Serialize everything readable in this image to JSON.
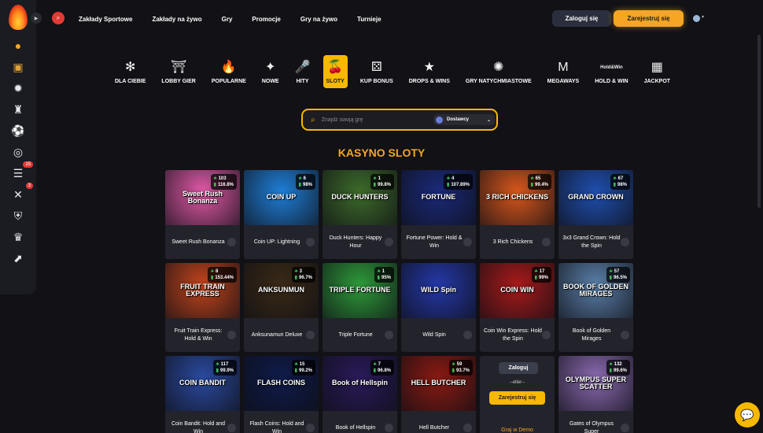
{
  "header": {
    "nav": [
      "Zakłady Sportowe",
      "Zakłady na żywo",
      "Gry",
      "Promocje",
      "Gry na żywo",
      "Turnieje"
    ],
    "login_label": "Zaloguj się",
    "register_label": "Zarejestruj się"
  },
  "sidebar": {
    "items": [
      {
        "icon": "slot-icon",
        "badge": ""
      },
      {
        "icon": "chest-icon",
        "badge": ""
      },
      {
        "icon": "sun-icon",
        "badge": ""
      },
      {
        "icon": "knight-icon",
        "badge": ""
      },
      {
        "icon": "football-icon",
        "badge": ""
      },
      {
        "icon": "live-icon",
        "badge": ""
      },
      {
        "icon": "coupon-icon",
        "badge": "15"
      },
      {
        "icon": "swords-icon",
        "badge": "3"
      },
      {
        "icon": "shield-icon",
        "badge": ""
      },
      {
        "icon": "crown-icon",
        "badge": ""
      },
      {
        "icon": "chart-icon",
        "badge": ""
      }
    ]
  },
  "categories": [
    {
      "label": "DLA CIEBIE",
      "icon": "✻",
      "active": false
    },
    {
      "label": "LOBBY GIER",
      "icon": "⛩",
      "active": false
    },
    {
      "label": "POPULARNE",
      "icon": "🔥",
      "active": false
    },
    {
      "label": "NOWE",
      "icon": "✦",
      "active": false
    },
    {
      "label": "HITY",
      "icon": "🎤",
      "active": false
    },
    {
      "label": "SLOTY",
      "icon": "🍒",
      "active": true
    },
    {
      "label": "KUP BONUS",
      "icon": "⚄",
      "active": false
    },
    {
      "label": "DROPS & WINS",
      "icon": "★",
      "active": false
    },
    {
      "label": "GRY NATYCHMIASTOWE",
      "icon": "✺",
      "active": false
    },
    {
      "label": "MEGAWAYS",
      "icon": "M",
      "active": false
    },
    {
      "label": "HOLD & WIN",
      "icon": "Hold&Win",
      "active": false
    },
    {
      "label": "JACKPOT",
      "icon": "▦",
      "active": false
    }
  ],
  "search": {
    "placeholder": "Znajdź swoją grę",
    "providers_label": "Dostawcy"
  },
  "section_title": "KASYNO SLOTY",
  "games": [
    {
      "title": "Sweet Rush Bonanza",
      "art": "Sweet Rush Bonanza",
      "count": "103",
      "rtp": "116.8%",
      "color": "#e25aa8"
    },
    {
      "title": "Coin UP: Lightning",
      "art": "COIN UP",
      "count": "6",
      "rtp": "98%",
      "color": "#1f7fd8"
    },
    {
      "title": "Duck Hunters: Happy Hour",
      "art": "DUCK HUNTERS",
      "count": "1",
      "rtp": "99.8%",
      "color": "#3d6b2a"
    },
    {
      "title": "Fortune Power: Hold & Win",
      "art": "FORTUNE",
      "count": "4",
      "rtp": "107.89%",
      "color": "#1a2a7a"
    },
    {
      "title": "3 Rich Chickens",
      "art": "3 RICH CHICKENS",
      "count": "65",
      "rtp": "99.4%",
      "color": "#d8571c"
    },
    {
      "title": "3x3 Grand Crown: Hold the Spin",
      "art": "GRAND CROWN",
      "count": "67",
      "rtp": "98%",
      "color": "#1f4fb0"
    },
    {
      "title": "Fruit Train Express: Hold & Win",
      "art": "FRUIT TRAIN EXPRESS",
      "count": "8",
      "rtp": "153.44%",
      "color": "#c2441c"
    },
    {
      "title": "Anksunamun Deluxe",
      "art": "ANKSUNMUN",
      "count": "3",
      "rtp": "96.7%",
      "color": "#3a2a16"
    },
    {
      "title": "Triple Fortune",
      "art": "TRIPLE FORTUNE",
      "count": "1",
      "rtp": "95%",
      "color": "#2e9a3a"
    },
    {
      "title": "Wild Spin",
      "art": "WILD Spin",
      "count": "",
      "rtp": "",
      "color": "#2438a8"
    },
    {
      "title": "Coin Win Express: Hold the Spin",
      "art": "COIN WIN",
      "count": "17",
      "rtp": "99%",
      "color": "#a81a1a"
    },
    {
      "title": "Book of Golden Mirages",
      "art": "BOOK OF GOLDEN MIRAGES",
      "count": "57",
      "rtp": "96.5%",
      "color": "#5a7fa8"
    },
    {
      "title": "Coin Bandit: Hold and Win",
      "art": "COIN BANDIT",
      "count": "117",
      "rtp": "99.9%",
      "color": "#2a4aa0"
    },
    {
      "title": "Flash Coins: Hold and Win",
      "art": "FLASH COINS",
      "count": "15",
      "rtp": "99.2%",
      "color": "#0f1b4a"
    },
    {
      "title": "Book of Hellspin",
      "art": "Book of Hellspin",
      "count": "7",
      "rtp": "96.8%",
      "color": "#2a1a5a"
    },
    {
      "title": "Hell Butcher",
      "art": "HELL BUTCHER",
      "count": "59",
      "rtp": "93.7%",
      "color": "#8a1a12"
    },
    {
      "title": "",
      "art": "",
      "count": "",
      "rtp": "",
      "color": "#23232c",
      "login_card": true
    },
    {
      "title": "Gates of Olympus Super",
      "art": "OLYMPUS SUPER SCATTER",
      "count": "132",
      "rtp": "99.6%",
      "color": "#8a6ab0"
    }
  ],
  "login_card": {
    "login_label": "Zaloguj",
    "or_label": "--eller--",
    "register_label": "Zarejestruj się",
    "demo_label": "Graj w Demo"
  }
}
